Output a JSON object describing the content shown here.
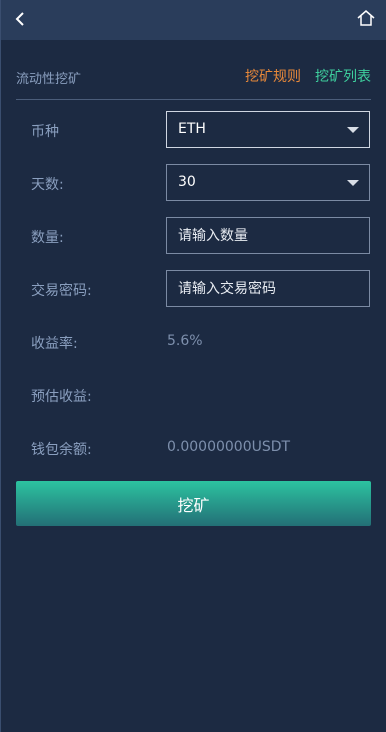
{
  "header": {
    "back_icon": "chevron-left-icon",
    "home_icon": "home-icon"
  },
  "section": {
    "title": "流动性挖矿",
    "rules_link": "挖矿规则",
    "list_link": "挖矿列表",
    "rules_color": "#e8893a",
    "list_color": "#3ecf9e"
  },
  "form": {
    "currency_label": "币种",
    "currency_value": "ETH",
    "days_label": "天数:",
    "days_value": "30",
    "amount_label": "数量:",
    "amount_placeholder": "请输入数量",
    "password_label": "交易密码:",
    "password_placeholder": "请输入交易密码",
    "yield_label": "收益率:",
    "yield_value": "5.6%",
    "expected_label": "预估收益:",
    "expected_value": "",
    "wallet_label": "钱包余额:",
    "wallet_value": "0.00000000USDT"
  },
  "actions": {
    "mine_button": "挖矿"
  }
}
